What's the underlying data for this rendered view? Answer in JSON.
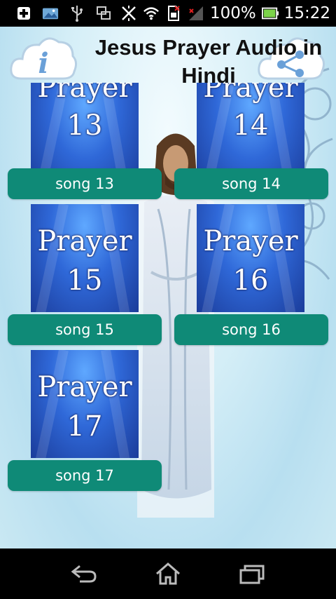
{
  "status_bar": {
    "battery": "100%",
    "time": "15:22",
    "icons": [
      "add-icon",
      "gallery-icon",
      "usb-icon",
      "screen-icon",
      "vibrate-icon",
      "wifi-icon",
      "sim-icon",
      "signal-icon",
      "battery-icon"
    ]
  },
  "header": {
    "title": "Jesus Prayer Audio in Hindi",
    "info_icon": "info-icon",
    "share_icon": "share-icon"
  },
  "items": [
    {
      "tile_word": "Prayer",
      "tile_number": "13",
      "button_label": "song 13"
    },
    {
      "tile_word": "Prayer",
      "tile_number": "14",
      "button_label": "song 14"
    },
    {
      "tile_word": "Prayer",
      "tile_number": "15",
      "button_label": "song 15"
    },
    {
      "tile_word": "Prayer",
      "tile_number": "16",
      "button_label": "song 16"
    },
    {
      "tile_word": "Prayer",
      "tile_number": "17",
      "button_label": "song 17"
    }
  ],
  "nav_bar": {
    "buttons": [
      "back-icon",
      "home-icon",
      "recent-apps-icon"
    ]
  },
  "colors": {
    "button": "#0f8a77",
    "tile": "#2f68d8",
    "status_bar": "#000000"
  }
}
